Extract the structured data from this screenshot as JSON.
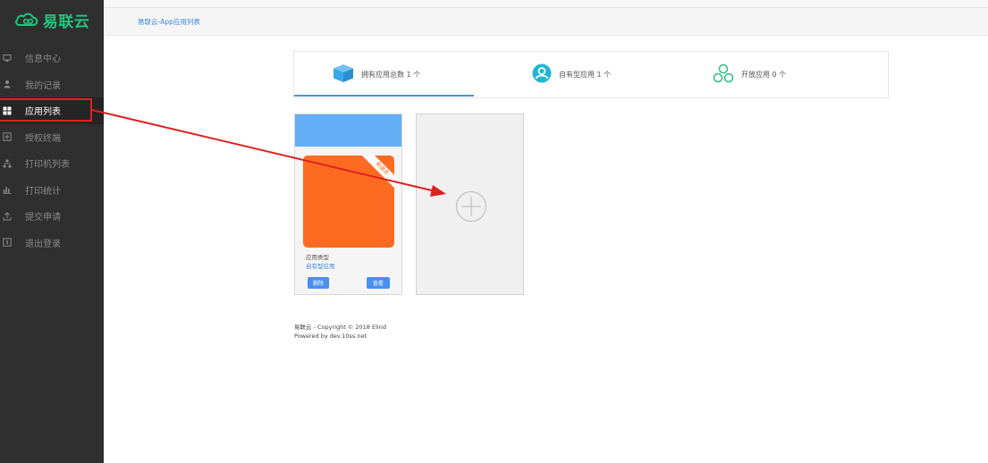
{
  "brand": {
    "name": "易联云",
    "color": "#1ec77a"
  },
  "sidebar": {
    "items": [
      {
        "label": "信息中心",
        "icon": "monitor-icon",
        "active": false
      },
      {
        "label": "我的记录",
        "icon": "user-icon",
        "active": false
      },
      {
        "label": "应用列表",
        "icon": "grid-icon",
        "active": true
      },
      {
        "label": "授权终端",
        "icon": "plus-square-icon",
        "active": false
      },
      {
        "label": "打印机列表",
        "icon": "sitemap-icon",
        "active": false
      },
      {
        "label": "打印统计",
        "icon": "bar-chart-icon",
        "active": false
      },
      {
        "label": "提交申请",
        "icon": "upload-icon",
        "active": false
      },
      {
        "label": "退出登录",
        "icon": "logout-icon",
        "active": false
      }
    ]
  },
  "breadcrumb": "易联云-App应用列表",
  "stats": [
    {
      "label": "拥有应用总数 1 个",
      "icon": "cube-icon",
      "color": "#3aa5e8",
      "active": true
    },
    {
      "label": "自有型应用 1 个",
      "icon": "person-circle-icon",
      "color": "#1fb6d2",
      "active": false
    },
    {
      "label": "开放应用 0 个",
      "icon": "share-nodes-icon",
      "color": "#2dbd84",
      "active": false
    }
  ],
  "app_card": {
    "ribbon": "新建态",
    "type_label": "应用类型",
    "type_value": "自有型应用",
    "delete_label": "删除",
    "view_label": "查看",
    "header_color": "#64aef5",
    "icon_color": "#fd6b22"
  },
  "add_card": {
    "icon": "add-circle-icon"
  },
  "footer": {
    "line1": "易联云 - Copyright © 2018 Elind",
    "line2": "Powered by dev.10ss.net"
  },
  "annotation": {
    "color": "#e02020"
  }
}
